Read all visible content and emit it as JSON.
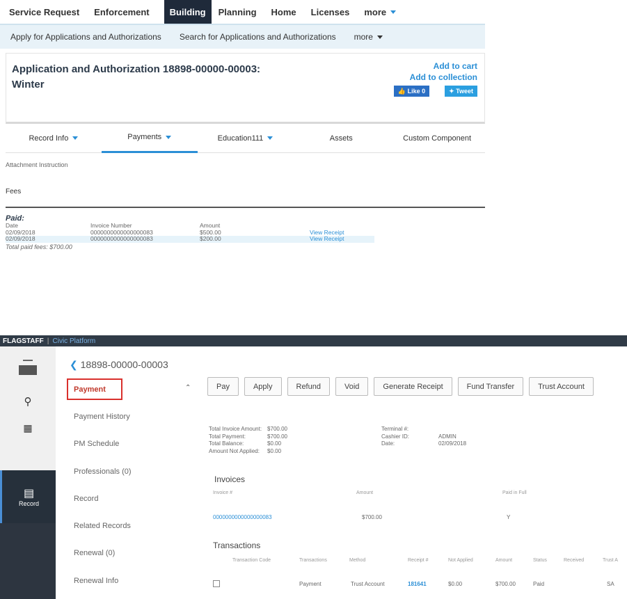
{
  "top_nav": {
    "items": [
      "Service Request",
      "Enforcement",
      "Building",
      "Planning",
      "Home",
      "Licenses"
    ],
    "active": "Building",
    "more_label": "more"
  },
  "sub_nav": {
    "items": [
      "Apply for Applications and Authorizations",
      "Search for Applications and Authorizations"
    ],
    "more_label": "more"
  },
  "record_card": {
    "title_line1": "Application and Authorization 18898-00000-00003:",
    "title_line2": "Winter",
    "add_to_cart": "Add to cart",
    "add_to_collection": "Add to collection",
    "like_label": "Like 0",
    "tweet_label": "Tweet"
  },
  "record_tabs": [
    {
      "label": "Record Info",
      "dropdown": true
    },
    {
      "label": "Payments",
      "dropdown": true
    },
    {
      "label": "Education111",
      "dropdown": true
    },
    {
      "label": "Assets",
      "dropdown": false
    },
    {
      "label": "Custom Component",
      "dropdown": false
    }
  ],
  "attachment_instruction": "Attachment Instruction",
  "fees": {
    "heading": "Fees",
    "paid_label": "Paid:",
    "columns": [
      "Date",
      "Invoice Number",
      "Amount"
    ],
    "rows": [
      {
        "date": "02/09/2018",
        "invoice": "0000000000000000083",
        "amount": "$500.00",
        "action": "View Receipt"
      },
      {
        "date": "02/09/2018",
        "invoice": "0000000000000000083",
        "amount": "$200.00",
        "action": "View Receipt"
      }
    ],
    "total": "Total paid fees: $700.00"
  },
  "civic": {
    "brand": "FLAGSTAFF",
    "product": "Civic Platform",
    "record_label": "Record",
    "record_id": "18898-00000-00003",
    "menu": [
      "Payment",
      "Payment History",
      "PM Schedule",
      "Professionals (0)",
      "Record",
      "Related Records",
      "Renewal (0)",
      "Renewal Info"
    ],
    "toolbar": [
      "Pay",
      "Apply",
      "Refund",
      "Void",
      "Generate Receipt",
      "Fund Transfer",
      "Trust Account"
    ],
    "summary_left": [
      [
        "Total Invoice Amount:",
        "$700.00"
      ],
      [
        "Total Payment:",
        "$700.00"
      ],
      [
        "Total Balance:",
        "$0.00"
      ],
      [
        "Amount Not Applied:",
        "$0.00"
      ]
    ],
    "summary_right": [
      [
        "Terminal #:",
        ""
      ],
      [
        "Cashier ID:",
        "ADMIN"
      ],
      [
        "Date:",
        "02/09/2018"
      ]
    ],
    "invoices": {
      "heading": "Invoices",
      "columns": [
        "Invoice #",
        "Amount",
        "Paid in Full"
      ],
      "row": {
        "invoice": "0000000000000000083",
        "amount": "$700.00",
        "paid": "Y"
      }
    },
    "transactions": {
      "heading": "Transactions",
      "columns": [
        "Transaction Code",
        "Transactions",
        "Method",
        "Receipt #",
        "Not Applied",
        "Amount",
        "Status",
        "Received",
        "Trust A"
      ],
      "row": {
        "transaction": "Payment",
        "method": "Trust Account",
        "receipt": "181641",
        "not_applied": "$0.00",
        "amount": "$700.00",
        "status": "Paid",
        "trust": "SA"
      }
    }
  }
}
